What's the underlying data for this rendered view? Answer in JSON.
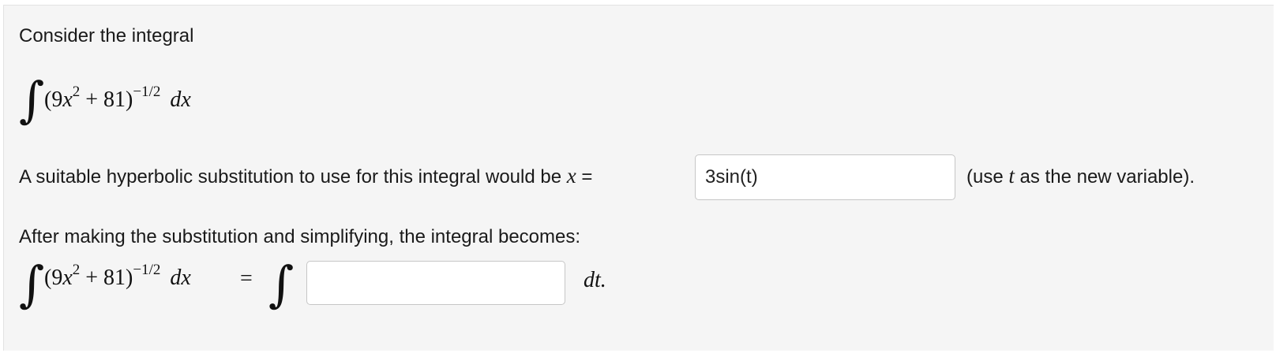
{
  "intro": "Consider the integral",
  "integral": {
    "base_open": "(9",
    "var_x": "x",
    "sq": "2",
    "plus_const": " + 81)",
    "exponent": "−1/2",
    "dx": "dx"
  },
  "question1": {
    "prefix": "A suitable hyperbolic substitution to use for this integral would be ",
    "var": "x",
    "equals": " =",
    "answer_value": "3sin(t)",
    "hint_open": "(use ",
    "hint_var": "t",
    "hint_close": " as the new variable)."
  },
  "question2": {
    "prompt": "After making the substitution and simplifying, the integral becomes:",
    "equals": "=",
    "answer_value": "",
    "dt": "dt."
  }
}
